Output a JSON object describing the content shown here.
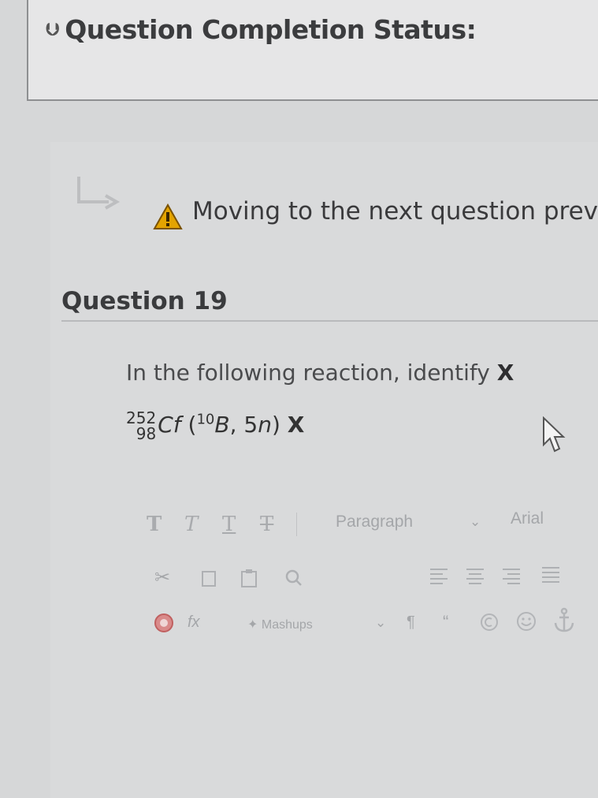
{
  "status": {
    "title": "Question Completion Status:",
    "chevron_icon": "chevron-down-double-icon"
  },
  "warning": {
    "text": "Moving to the next question prevent",
    "icon": "warning-triangle-icon",
    "arrow_icon": "nav-return-arrow-icon",
    "icon_color": "#e3a300"
  },
  "question": {
    "title": "Question 19",
    "prompt_prefix": "In the following reaction, identify ",
    "prompt_var": "X",
    "reaction": {
      "mass_number": "252",
      "atomic_number": "98",
      "symbol": "Cf",
      "open": " (",
      "projectile_mass": "10",
      "projectile": "B",
      "rest": ", 5",
      "neutron": "n",
      "close": ") ",
      "product": "X"
    }
  },
  "toolbar": {
    "row1": [
      "T",
      "T",
      "T",
      "T"
    ],
    "paragraph_label": "Paragraph",
    "font_label": "Arial",
    "mashups_label": "Mashups",
    "fx_label": "fx"
  }
}
